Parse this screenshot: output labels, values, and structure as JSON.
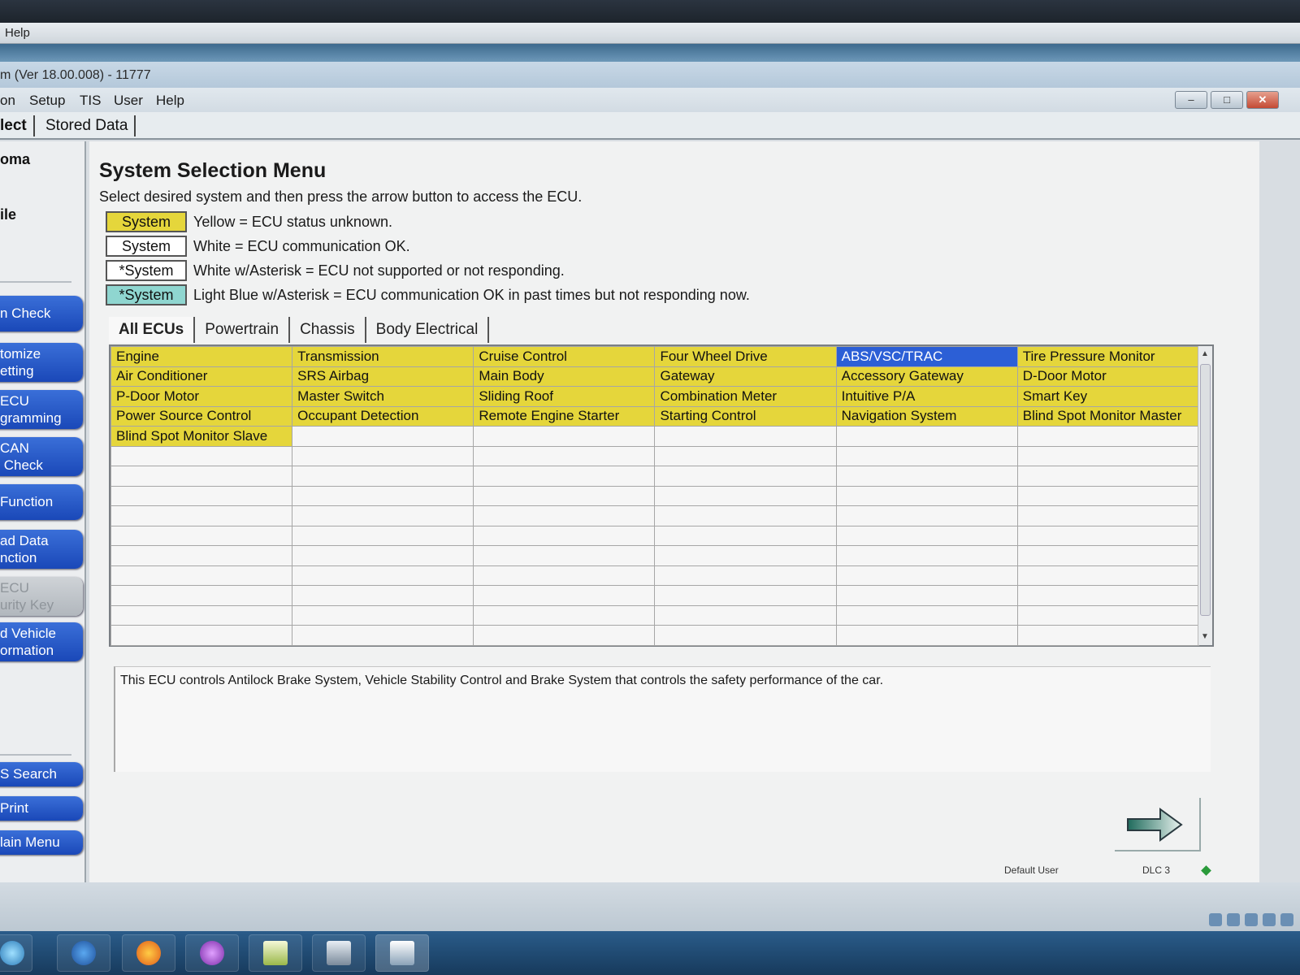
{
  "outer": {
    "menu_label": "Help"
  },
  "app": {
    "title": "m (Ver 18.00.008) - 11777",
    "window_controls": [
      "–",
      "□",
      "✕"
    ],
    "menu": [
      "on",
      "Setup",
      "TIS",
      "User",
      "Help"
    ],
    "tabs": [
      "lect",
      "Stored Data"
    ]
  },
  "sidebar": {
    "labels": [
      "oma",
      "ile"
    ],
    "buttons": [
      {
        "label": "n Check"
      },
      {
        "label": "tomize\netting"
      },
      {
        "label": "ECU\ngramming"
      },
      {
        "label": "CAN\n Check"
      },
      {
        "label": "Function"
      },
      {
        "label": "ad Data\nnction"
      },
      {
        "label": "ECU\nurity Key"
      },
      {
        "label": "d Vehicle\normation"
      },
      {
        "label": "S Search"
      },
      {
        "label": "Print"
      },
      {
        "label": "lain Menu"
      }
    ]
  },
  "main": {
    "title": "System Selection Menu",
    "instruction": "Select desired system and then press the arrow button to access the ECU.",
    "legend": [
      {
        "box": "System",
        "text": "Yellow = ECU status unknown.",
        "color": "#e5d63b"
      },
      {
        "box": "System",
        "text": "White = ECU communication OK.",
        "color": "#ffffff"
      },
      {
        "box": "*System",
        "text": "White w/Asterisk = ECU not supported or not responding.",
        "color": "#ffffff"
      },
      {
        "box": "*System",
        "text": "Light Blue w/Asterisk = ECU communication OK in past times but not responding now.",
        "color": "#8fd6d0"
      }
    ],
    "ecu_tabs": [
      "All ECUs",
      "Powertrain",
      "Chassis",
      "Body Electrical"
    ],
    "grid": [
      [
        "Engine",
        "Transmission",
        "Cruise Control",
        "Four Wheel Drive",
        "ABS/VSC/TRAC",
        "Tire Pressure Monitor"
      ],
      [
        "Air Conditioner",
        "SRS Airbag",
        "Main Body",
        "Gateway",
        "Accessory Gateway",
        "D-Door Motor"
      ],
      [
        "P-Door Motor",
        "Master Switch",
        "Sliding Roof",
        "Combination Meter",
        "Intuitive P/A",
        "Smart Key"
      ],
      [
        "Power Source Control",
        "Occupant Detection",
        "Remote Engine Starter",
        "Starting Control",
        "Navigation System",
        "Blind Spot Monitor Master"
      ],
      [
        "Blind Spot Monitor Slave",
        "",
        "",
        "",
        "",
        ""
      ]
    ],
    "selected_system": "ABS/VSC/TRAC",
    "description": "This ECU controls Antilock Brake System, Vehicle Stability Control and Brake System that controls the safety performance of the car.",
    "status": {
      "user": "Default User",
      "connector": "DLC 3"
    }
  },
  "colors": {
    "yellow": "#e5d63b",
    "selected": "#2c5fd6",
    "sidebar_button": "#1a48b8"
  }
}
